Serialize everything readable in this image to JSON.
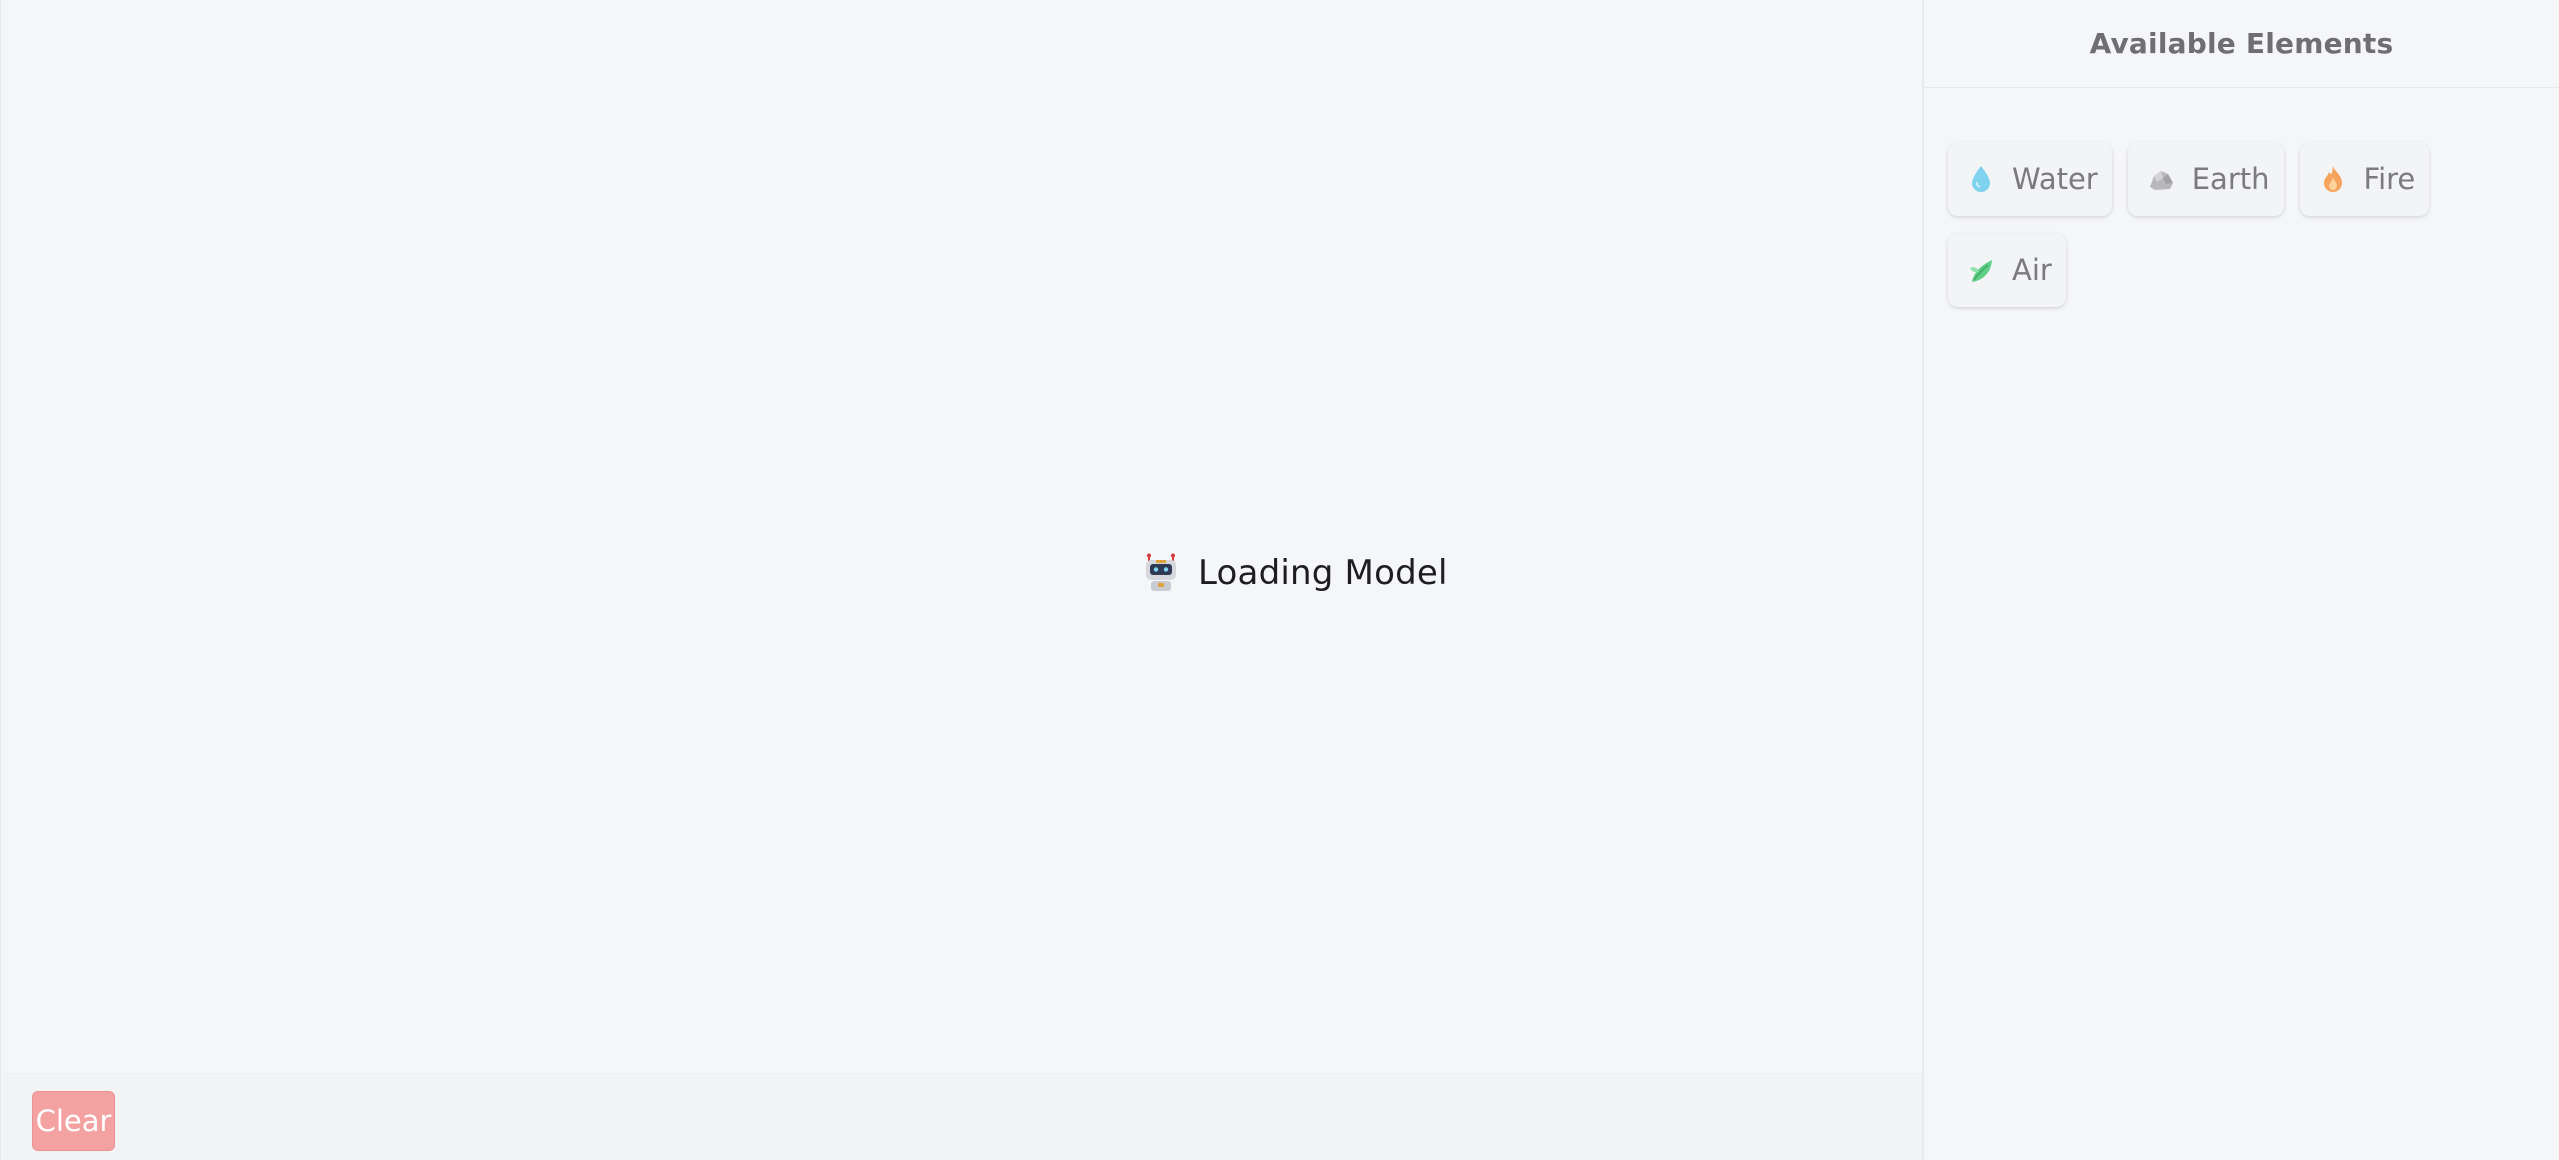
{
  "canvas": {
    "loading_label": "Loading Model",
    "loading_icon": "robot-icon",
    "clear_label": "Clear"
  },
  "sidebar": {
    "title": "Available Elements",
    "elements": [
      {
        "label": "Water",
        "icon": "water-drop-icon",
        "color": "#7fd3ef"
      },
      {
        "label": "Earth",
        "icon": "rock-icon",
        "color": "#b8b8bb"
      },
      {
        "label": "Fire",
        "icon": "fire-icon",
        "color": "#f6a35d"
      },
      {
        "label": "Air",
        "icon": "leaf-icon",
        "color": "#5fcf86"
      }
    ]
  },
  "colors": {
    "background": "#f5f6f8",
    "clear_button": "#f3a1a1"
  }
}
